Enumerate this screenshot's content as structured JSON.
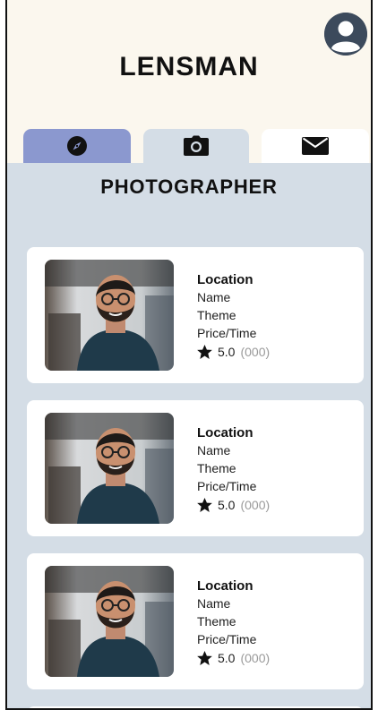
{
  "app": {
    "title": "LENSMAN"
  },
  "section": {
    "title": "PHOTOGRAPHER"
  },
  "tabs": [
    {
      "id": "explore",
      "icon": "compass-icon",
      "active": false
    },
    {
      "id": "camera",
      "icon": "camera-icon",
      "active": true
    },
    {
      "id": "messages",
      "icon": "envelope-icon",
      "active": false
    }
  ],
  "photographers": [
    {
      "location": "Location",
      "name": "Name",
      "theme": "Theme",
      "price": "Price/Time",
      "rating": "5.0",
      "reviews": "(000)",
      "photo_icon": "photographer-photo"
    },
    {
      "location": "Location",
      "name": "Name",
      "theme": "Theme",
      "price": "Price/Time",
      "rating": "5.0",
      "reviews": "(000)",
      "photo_icon": "photographer-photo"
    },
    {
      "location": "Location",
      "name": "Name",
      "theme": "Theme",
      "price": "Price/Time",
      "rating": "5.0",
      "reviews": "(000)",
      "photo_icon": "photographer-photo"
    }
  ],
  "colors": {
    "header_bg": "#fbf7ee",
    "content_bg": "#d4dde6",
    "tab_explore": "#8b98cf",
    "tab_mail": "#ffffff",
    "avatar": "#3c4a5c"
  }
}
